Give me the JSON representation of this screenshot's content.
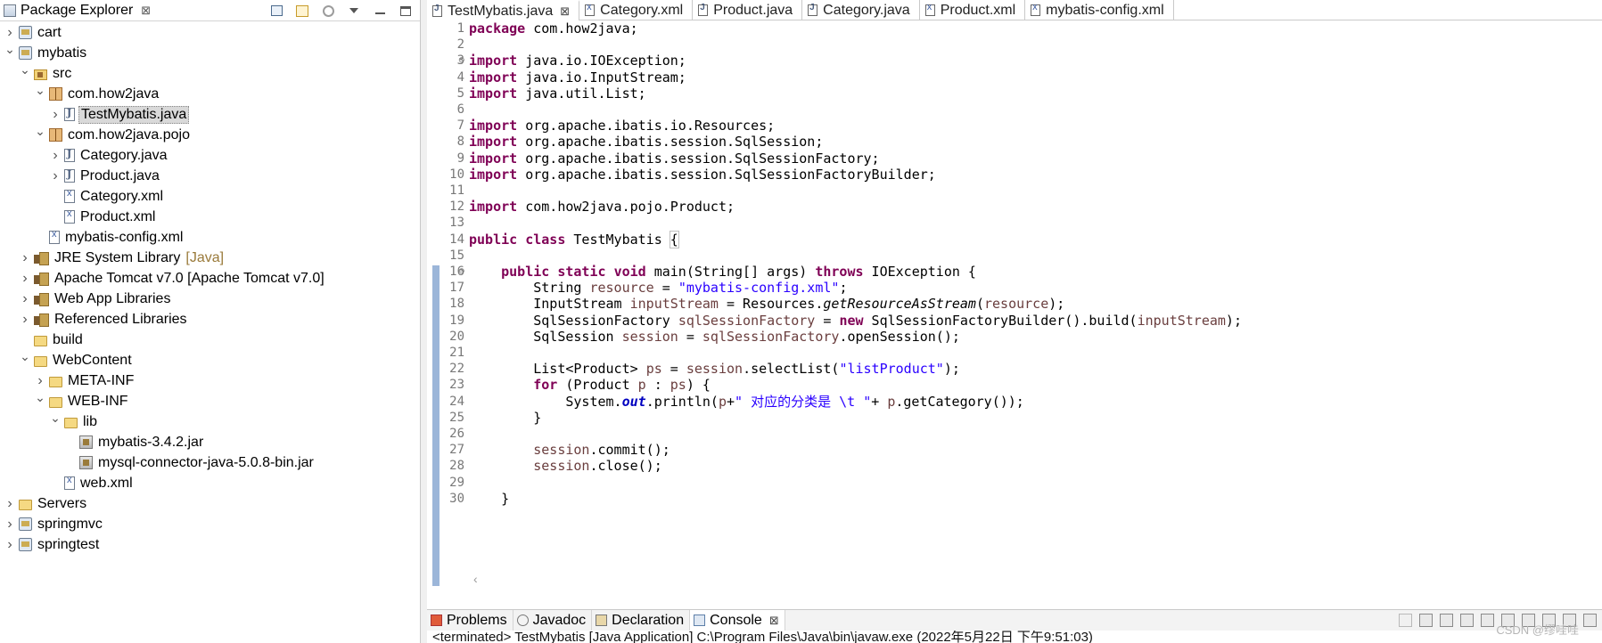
{
  "explorer": {
    "title": "Package Explorer",
    "close_glyph": "⊠",
    "tree": [
      {
        "label": "cart",
        "depth": 0,
        "twisty": "closed",
        "icon": "project-icon"
      },
      {
        "label": "mybatis",
        "depth": 0,
        "twisty": "open",
        "icon": "project-icon"
      },
      {
        "label": "src",
        "depth": 1,
        "twisty": "open",
        "icon": "source-folder-icon"
      },
      {
        "label": "com.how2java",
        "depth": 2,
        "twisty": "open",
        "icon": "package-icon"
      },
      {
        "label": "TestMybatis.java",
        "depth": 3,
        "twisty": "closed",
        "icon": "java-file-icon",
        "selected": true
      },
      {
        "label": "com.how2java.pojo",
        "depth": 2,
        "twisty": "open",
        "icon": "package-icon"
      },
      {
        "label": "Category.java",
        "depth": 3,
        "twisty": "closed",
        "icon": "java-file-icon"
      },
      {
        "label": "Product.java",
        "depth": 3,
        "twisty": "closed",
        "icon": "java-file-icon"
      },
      {
        "label": "Category.xml",
        "depth": 3,
        "twisty": "none",
        "icon": "xml-file-icon"
      },
      {
        "label": "Product.xml",
        "depth": 3,
        "twisty": "none",
        "icon": "xml-file-icon"
      },
      {
        "label": "mybatis-config.xml",
        "depth": 2,
        "twisty": "none",
        "icon": "xml-file-icon"
      },
      {
        "label": "JRE System Library",
        "decor": "[Java]",
        "depth": 1,
        "twisty": "closed",
        "icon": "library-icon"
      },
      {
        "label": "Apache Tomcat v7.0 [Apache Tomcat v7.0]",
        "depth": 1,
        "twisty": "closed",
        "icon": "library-icon"
      },
      {
        "label": "Web App Libraries",
        "depth": 1,
        "twisty": "closed",
        "icon": "library-icon"
      },
      {
        "label": "Referenced Libraries",
        "depth": 1,
        "twisty": "closed",
        "icon": "library-icon"
      },
      {
        "label": "build",
        "depth": 1,
        "twisty": "none",
        "icon": "folder-icon"
      },
      {
        "label": "WebContent",
        "depth": 1,
        "twisty": "open",
        "icon": "folder-icon"
      },
      {
        "label": "META-INF",
        "depth": 2,
        "twisty": "closed",
        "icon": "folder-icon"
      },
      {
        "label": "WEB-INF",
        "depth": 2,
        "twisty": "open",
        "icon": "folder-icon"
      },
      {
        "label": "lib",
        "depth": 3,
        "twisty": "open",
        "icon": "folder-icon"
      },
      {
        "label": "mybatis-3.4.2.jar",
        "depth": 4,
        "twisty": "none",
        "icon": "jar-icon"
      },
      {
        "label": "mysql-connector-java-5.0.8-bin.jar",
        "depth": 4,
        "twisty": "none",
        "icon": "jar-icon"
      },
      {
        "label": "web.xml",
        "depth": 3,
        "twisty": "none",
        "icon": "xml-file-icon"
      },
      {
        "label": "Servers",
        "depth": 0,
        "twisty": "closed",
        "icon": "folder-icon"
      },
      {
        "label": "springmvc",
        "depth": 0,
        "twisty": "closed",
        "icon": "project-icon"
      },
      {
        "label": "springtest",
        "depth": 0,
        "twisty": "closed",
        "icon": "project-icon"
      }
    ]
  },
  "editor": {
    "tabs": [
      {
        "label": "TestMybatis.java",
        "type": "java",
        "active": true,
        "close": "⊠"
      },
      {
        "label": "Category.xml",
        "type": "xml"
      },
      {
        "label": "Product.java",
        "type": "java"
      },
      {
        "label": "Category.java",
        "type": "java"
      },
      {
        "label": "Product.xml",
        "type": "xml"
      },
      {
        "label": "mybatis-config.xml",
        "type": "xml"
      }
    ],
    "fold_lines": [
      3,
      16
    ],
    "lines": [
      [
        [
          "kw",
          "package"
        ],
        [
          "plain",
          " com.how2java;"
        ]
      ],
      [],
      [
        [
          "kw",
          "import"
        ],
        [
          "plain",
          " java.io.IOException;"
        ]
      ],
      [
        [
          "kw",
          "import"
        ],
        [
          "plain",
          " java.io.InputStream;"
        ]
      ],
      [
        [
          "kw",
          "import"
        ],
        [
          "plain",
          " java.util.List;"
        ]
      ],
      [],
      [
        [
          "kw",
          "import"
        ],
        [
          "plain",
          " org.apache.ibatis.io.Resources;"
        ]
      ],
      [
        [
          "kw",
          "import"
        ],
        [
          "plain",
          " org.apache.ibatis.session.SqlSession;"
        ]
      ],
      [
        [
          "kw",
          "import"
        ],
        [
          "plain",
          " org.apache.ibatis.session.SqlSessionFactory;"
        ]
      ],
      [
        [
          "kw",
          "import"
        ],
        [
          "plain",
          " org.apache.ibatis.session.SqlSessionFactoryBuilder;"
        ]
      ],
      [],
      [
        [
          "kw",
          "import"
        ],
        [
          "plain",
          " com.how2java.pojo.Product;"
        ]
      ],
      [],
      [
        [
          "kw",
          "public"
        ],
        [
          "plain",
          " "
        ],
        [
          "kw",
          "class"
        ],
        [
          "plain",
          " TestMybatis "
        ],
        [
          "brace",
          "{"
        ]
      ],
      [],
      [
        [
          "plain",
          "    "
        ],
        [
          "kw",
          "public"
        ],
        [
          "plain",
          " "
        ],
        [
          "kw",
          "static"
        ],
        [
          "plain",
          " "
        ],
        [
          "kw",
          "void"
        ],
        [
          "plain",
          " main(String[] args) "
        ],
        [
          "kw",
          "throws"
        ],
        [
          "plain",
          " IOException {"
        ]
      ],
      [
        [
          "plain",
          "        String "
        ],
        [
          "var",
          "resource"
        ],
        [
          "plain",
          " = "
        ],
        [
          "str",
          "\"mybatis-config.xml\""
        ],
        [
          "plain",
          ";"
        ]
      ],
      [
        [
          "plain",
          "        InputStream "
        ],
        [
          "var",
          "inputStream"
        ],
        [
          "plain",
          " = Resources."
        ],
        [
          "mth",
          "getResourceAsStream"
        ],
        [
          "plain",
          "("
        ],
        [
          "var",
          "resource"
        ],
        [
          "plain",
          ");"
        ]
      ],
      [
        [
          "plain",
          "        SqlSessionFactory "
        ],
        [
          "var",
          "sqlSessionFactory"
        ],
        [
          "plain",
          " = "
        ],
        [
          "kw",
          "new"
        ],
        [
          "plain",
          " SqlSessionFactoryBuilder().build("
        ],
        [
          "var",
          "inputStream"
        ],
        [
          "plain",
          ");"
        ]
      ],
      [
        [
          "plain",
          "        SqlSession "
        ],
        [
          "var",
          "session"
        ],
        [
          "plain",
          " = "
        ],
        [
          "var",
          "sqlSessionFactory"
        ],
        [
          "plain",
          ".openSession();"
        ]
      ],
      [],
      [
        [
          "plain",
          "        List<Product> "
        ],
        [
          "var",
          "ps"
        ],
        [
          "plain",
          " = "
        ],
        [
          "var",
          "session"
        ],
        [
          "plain",
          ".selectList("
        ],
        [
          "str",
          "\"listProduct\""
        ],
        [
          "plain",
          ");"
        ]
      ],
      [
        [
          "plain",
          "        "
        ],
        [
          "kw",
          "for"
        ],
        [
          "plain",
          " (Product "
        ],
        [
          "var",
          "p"
        ],
        [
          "plain",
          " : "
        ],
        [
          "var",
          "ps"
        ],
        [
          "plain",
          ") {"
        ]
      ],
      [
        [
          "plain",
          "            System."
        ],
        [
          "fld",
          "out"
        ],
        [
          "plain",
          ".println("
        ],
        [
          "var",
          "p"
        ],
        [
          "plain",
          "+"
        ],
        [
          "str",
          "\" 对应的分类是 \\t \""
        ],
        [
          "plain",
          "+ "
        ],
        [
          "var",
          "p"
        ],
        [
          "plain",
          ".getCategory());"
        ]
      ],
      [
        [
          "plain",
          "        }"
        ]
      ],
      [],
      [
        [
          "plain",
          "        "
        ],
        [
          "var",
          "session"
        ],
        [
          "plain",
          ".commit();"
        ]
      ],
      [
        [
          "plain",
          "        "
        ],
        [
          "var",
          "session"
        ],
        [
          "plain",
          ".close();"
        ]
      ],
      [],
      [
        [
          "plain",
          "    }"
        ]
      ]
    ]
  },
  "bottom": {
    "tabs": [
      {
        "label": "Problems",
        "icon": "problems-icon"
      },
      {
        "label": "Javadoc",
        "icon": "javadoc-icon"
      },
      {
        "label": "Declaration",
        "icon": "declaration-icon"
      },
      {
        "label": "Console",
        "icon": "console-icon",
        "active": true,
        "close": "⊠"
      }
    ],
    "console_text": "<terminated> TestMybatis [Java Application] C:\\Program Files\\Java\\bin\\javaw.exe (2022年5月22日 下午9:51:03)",
    "watermark": "CSDN @缪哇哇"
  },
  "colors": {
    "keyword": "#7f0055",
    "string": "#2a00ff",
    "variable": "#6a3e3e",
    "static_field": "#0000c0",
    "line_number": "#787878",
    "change_bar": "#9cb6d9"
  }
}
